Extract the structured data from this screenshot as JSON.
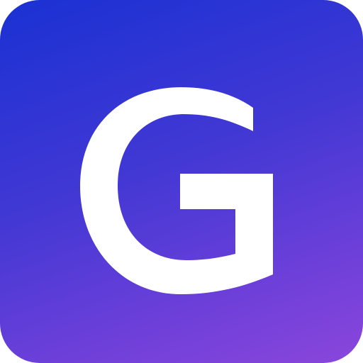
{
  "icon": {
    "letter": "G",
    "background_gradient": [
      "#1a31d3",
      "#4238d4",
      "#6b3fd9",
      "#8a46db"
    ],
    "foreground_color": "#ffffff"
  }
}
